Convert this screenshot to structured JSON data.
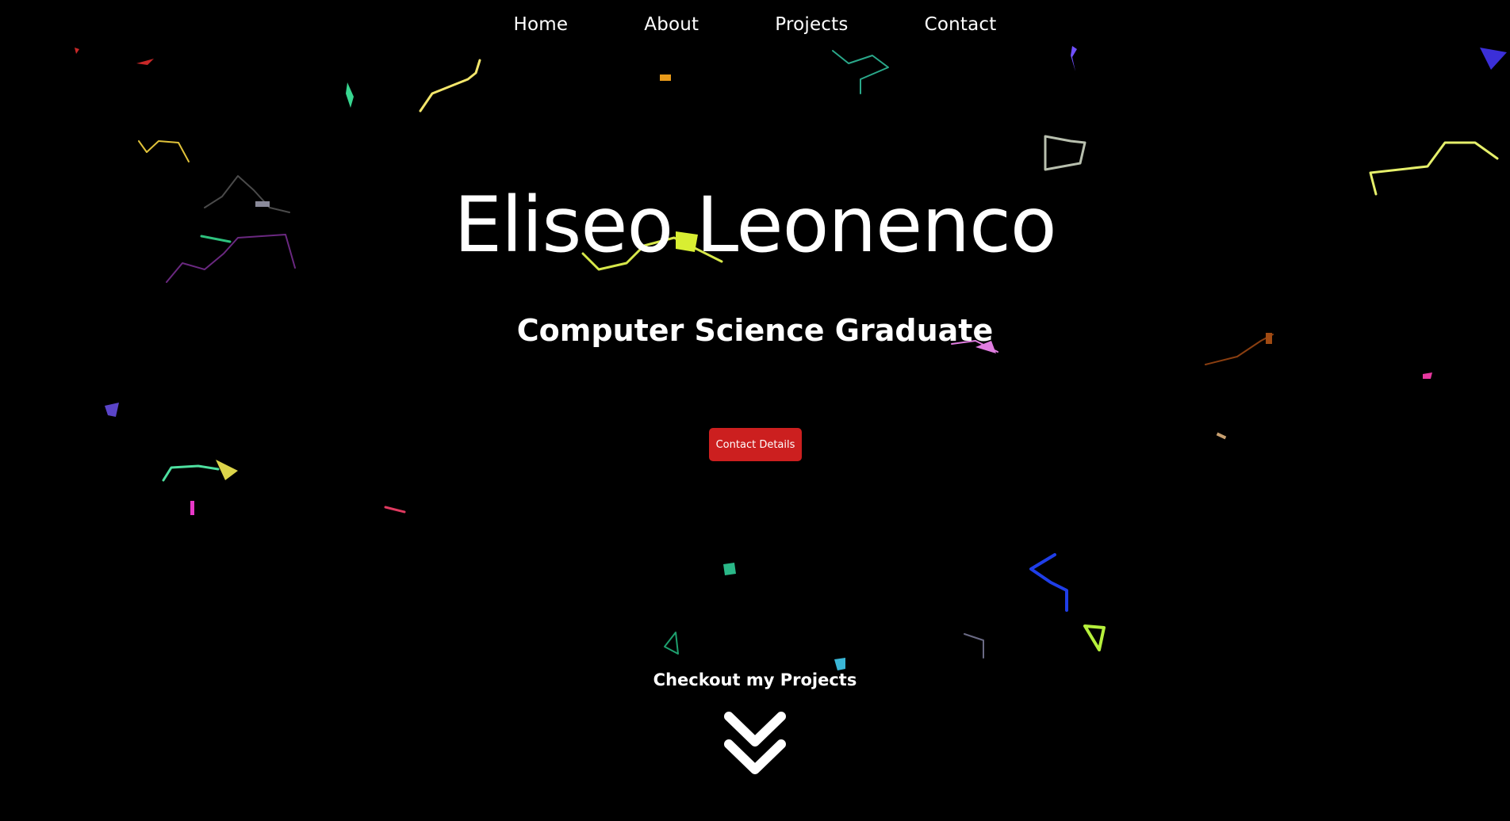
{
  "nav": {
    "items": [
      {
        "label": "Home"
      },
      {
        "label": "About"
      },
      {
        "label": "Projects"
      },
      {
        "label": "Contact"
      }
    ]
  },
  "hero": {
    "name": "Eliseo Leonenco",
    "subtitle": "Computer Science Graduate",
    "cta_label": "Contact Details",
    "projects_label": "Checkout my Projects"
  },
  "icons": {
    "scroll_arrow": "double-chevron-down-icon"
  },
  "colors": {
    "background": "#000000",
    "text": "#ffffff",
    "cta_background": "#cc1f1f"
  }
}
